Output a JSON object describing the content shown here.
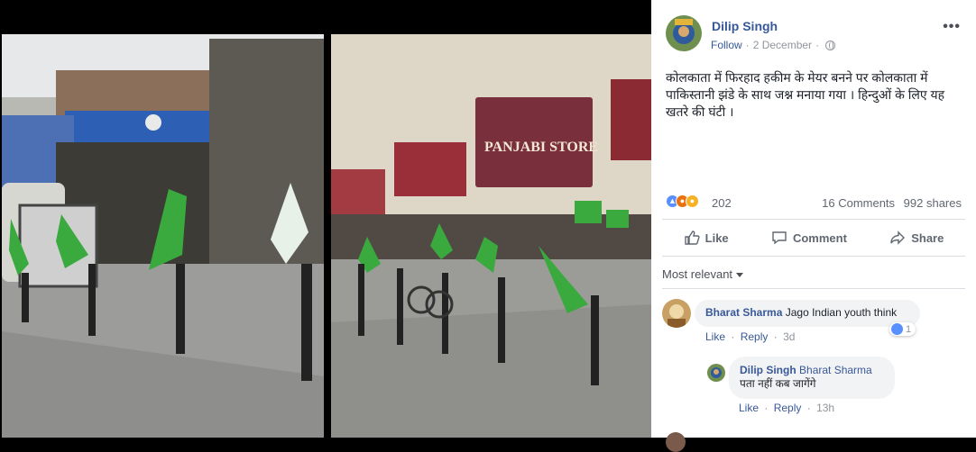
{
  "post": {
    "author": "Dilip Singh",
    "follow_label": "Follow",
    "separator": "·",
    "date": "2 December",
    "privacy_icon": "globe-icon",
    "more_label": "•••",
    "text": "कोलकाता में फिरहाद हकीम के मेयर बनने पर कोलकाता में पाकिस्तानी झंडे के साथ जश्न मनाया गया । हिन्दुओं के लिए यह खतरे की घंटी ।"
  },
  "photos": {
    "right_sign": "PANJABI STORE"
  },
  "stats": {
    "reactions": [
      "like-reaction-icon",
      "angry-reaction-icon",
      "sad-reaction-icon"
    ],
    "reaction_count": "202",
    "comments": "16 Comments",
    "shares": "992 shares"
  },
  "actions": {
    "like": "Like",
    "comment": "Comment",
    "share": "Share"
  },
  "sort": {
    "label": "Most relevant"
  },
  "comments": [
    {
      "author": "Bharat Sharma",
      "text": "Jago Indian youth think",
      "like": "Like",
      "reply": "Reply",
      "dot": "·",
      "time": "3d",
      "reaction_count": "1"
    },
    {
      "author": "Dilip Singh",
      "mention": "Bharat Sharma",
      "text": "पता नहीं कब जागेंगे",
      "like": "Like",
      "reply": "Reply",
      "dot": "·",
      "time": "13h"
    }
  ],
  "colors": {
    "link": "#365899",
    "meta": "#90949c",
    "flag_green": "#2fa84f",
    "like_blue": "#5890ff"
  }
}
